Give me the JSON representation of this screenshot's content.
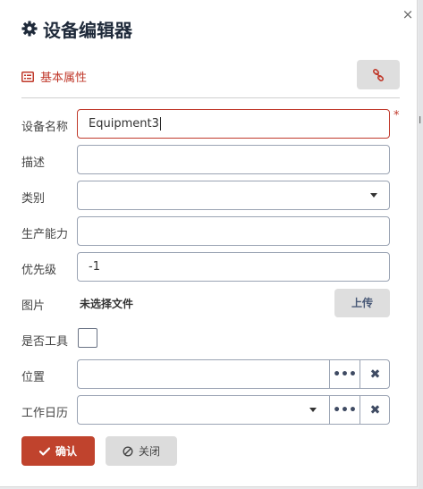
{
  "dialog": {
    "title": "设备编辑器",
    "close_glyph": "×",
    "side_glyph": "I"
  },
  "section": {
    "label": "基本属性"
  },
  "fields": {
    "name": {
      "label": "设备名称",
      "value": "Equipment3",
      "required_mark": "*"
    },
    "description": {
      "label": "描述",
      "value": ""
    },
    "category": {
      "label": "类别",
      "value": ""
    },
    "capacity": {
      "label": "生产能力",
      "value": ""
    },
    "priority": {
      "label": "优先级",
      "value": "-1"
    },
    "image": {
      "label": "图片",
      "status": "未选择文件",
      "upload_label": "上传"
    },
    "is_tool": {
      "label": "是否工具",
      "checked": false
    },
    "location": {
      "label": "位置",
      "value": "",
      "more_glyph": "•••",
      "clear_glyph": "✖"
    },
    "calendar": {
      "label": "工作日历",
      "value": "",
      "more_glyph": "•••",
      "clear_glyph": "✖"
    }
  },
  "footer": {
    "confirm_label": "确认",
    "cancel_label": "关闭"
  },
  "colors": {
    "accent": "#c0432d",
    "title": "#1f2a3a",
    "border": "#9aa3b3"
  },
  "icons": [
    "gear-icon",
    "list-icon",
    "link-icon",
    "close-icon",
    "check-icon",
    "cancel-circle-icon",
    "chevron-down-icon",
    "more-icon",
    "clear-icon"
  ]
}
